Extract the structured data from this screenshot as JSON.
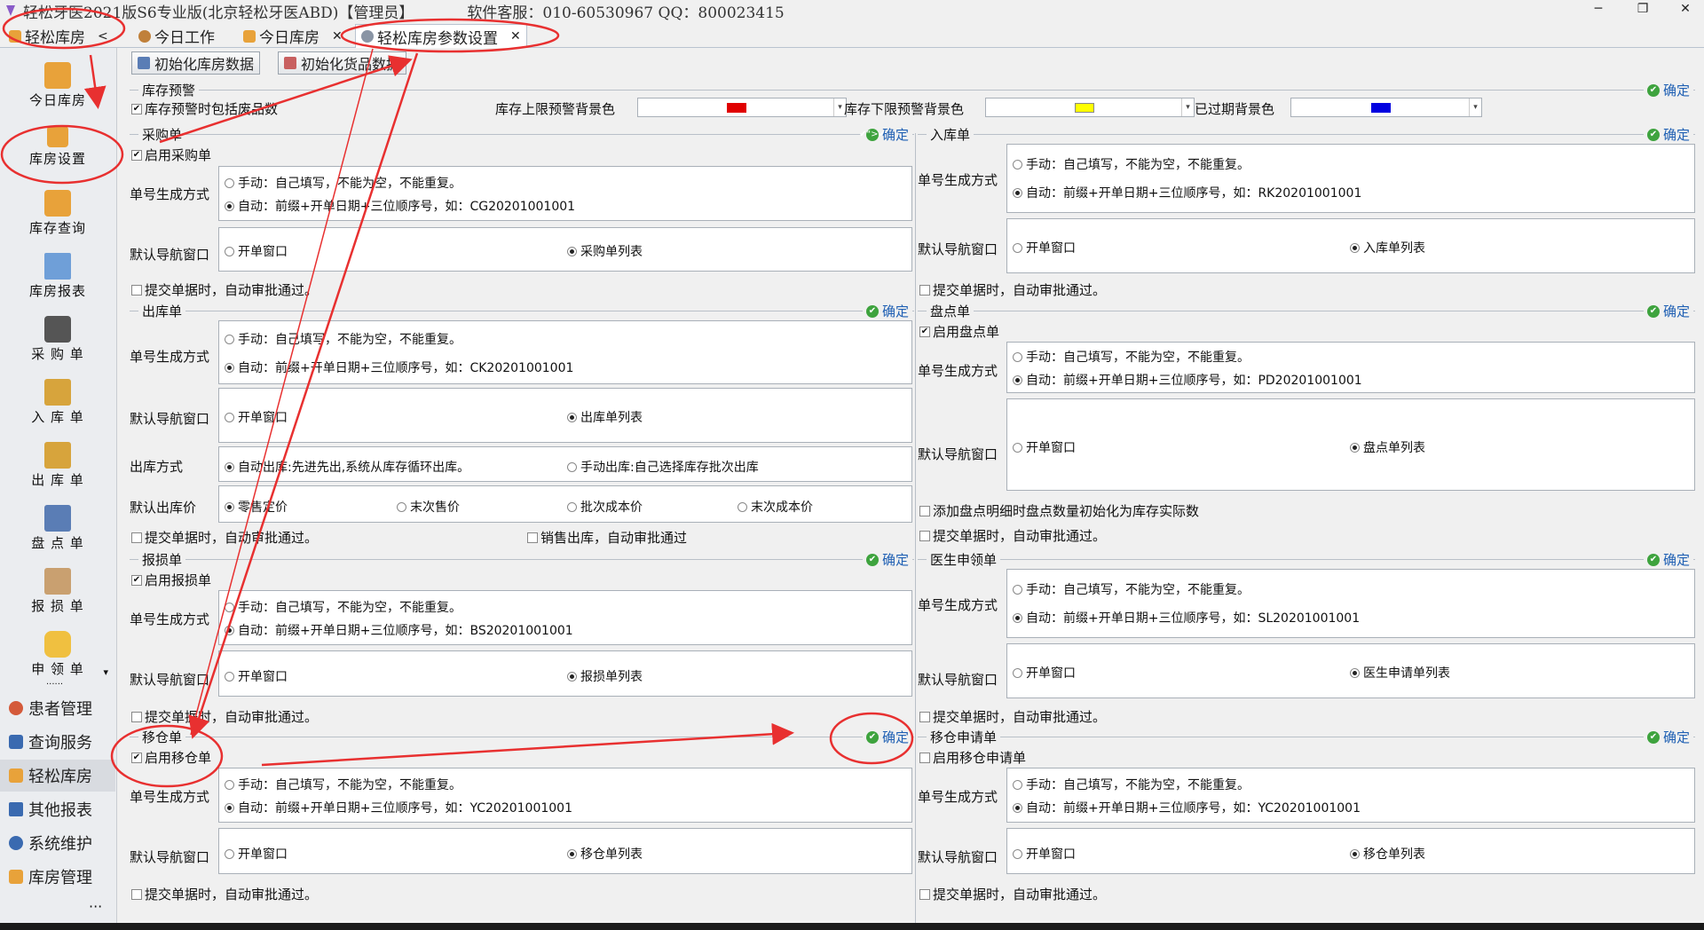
{
  "window": {
    "title": "轻松牙医2021版S6专业版(北京轻松牙医ABD)【管理员】",
    "support": "软件客服：010-60530967 QQ：800023415",
    "min": "─",
    "max": "❐",
    "close": "✕"
  },
  "tabs": [
    {
      "label": "轻松库房",
      "mark": "<"
    },
    {
      "label": "今日工作",
      "mark": "✕"
    },
    {
      "label": "今日库房",
      "mark": "✕"
    },
    {
      "label": "轻松库房参数设置",
      "mark": "✕"
    }
  ],
  "nav": {
    "items": [
      "今日库房",
      "库房设置",
      "库存查询",
      "库房报表",
      "采 购 单",
      "入 库 单",
      "出 库 单",
      "盘 点 单",
      "报 损 单",
      "申 领 单"
    ],
    "more_mark": "▾",
    "dots": "......"
  },
  "modules": [
    "患者管理",
    "查询服务",
    "轻松库房",
    "其他报表",
    "系统维护",
    "库房管理"
  ],
  "nav_footer": "···",
  "toolbar": {
    "init_stock": "初始化库房数据",
    "init_goods": "初始化货品数据"
  },
  "confirm": "确定",
  "alert": {
    "title": "库存预警",
    "include_waste": "库存预警时包括废品数",
    "upper": "库存上限预警背景色",
    "lower": "库存下限预警背景色",
    "expired": "已过期背景色",
    "upper_color": "#e00000",
    "lower_color": "#ffff00",
    "expired_color": "#0000e0",
    "dd": "▾"
  },
  "common": {
    "numgen": "单号生成方式",
    "nav": "默认导航窗口",
    "open_window": "开单窗口",
    "manual": "手动：自己填写，不能为空，不能重复。",
    "auto_submit": "提交单据时，自动审批通过。"
  },
  "purchase": {
    "title": "采购单",
    "enable": "启用采购单",
    "auto": "自动：前缀+开单日期+三位顺序号，如：CG20201001001",
    "list": "采购单列表"
  },
  "inbound": {
    "title": "入库单",
    "auto": "自动：前缀+开单日期+三位顺序号，如：RK20201001001",
    "list": "入库单列表"
  },
  "outbound": {
    "title": "出库单",
    "auto": "自动：前缀+开单日期+三位顺序号，如：CK20201001001",
    "list": "出库单列表",
    "method_label": "出库方式",
    "method_auto": "自动出库:先进先出,系统从库存循环出库。",
    "method_manual": "手动出库:自己选择库存批次出库",
    "price_label": "默认出库价",
    "price_opts": [
      "零售定价",
      "末次售价",
      "批次成本价",
      "末次成本价"
    ],
    "sales_auto": "销售出库，自动审批通过"
  },
  "stocktake": {
    "title": "盘点单",
    "enable": "启用盘点单",
    "auto": "自动：前缀+开单日期+三位顺序号，如：PD20201001001",
    "list": "盘点单列表",
    "init_qty": "添加盘点明细时盘点数量初始化为库存实际数"
  },
  "loss": {
    "title": "报损单",
    "enable": "启用报损单",
    "auto": "自动：前缀+开单日期+三位顺序号，如：BS20201001001",
    "list": "报损单列表"
  },
  "doctor": {
    "title": "医生申领单",
    "auto": "自动：前缀+开单日期+三位顺序号，如：SL20201001001",
    "list": "医生申请单列表"
  },
  "transfer": {
    "title": "移仓单",
    "enable": "启用移仓单",
    "auto": "自动：前缀+开单日期+三位顺序号，如：YC20201001001",
    "list": "移仓单列表"
  },
  "transfer_req": {
    "title": "移仓申请单",
    "enable": "启用移仓申请单",
    "auto": "自动：前缀+开单日期+三位顺序号，如：YC20201001001",
    "list": "移仓单列表"
  },
  "colors": {
    "accent": "#1e5fb3",
    "annotation": "#e83030"
  }
}
